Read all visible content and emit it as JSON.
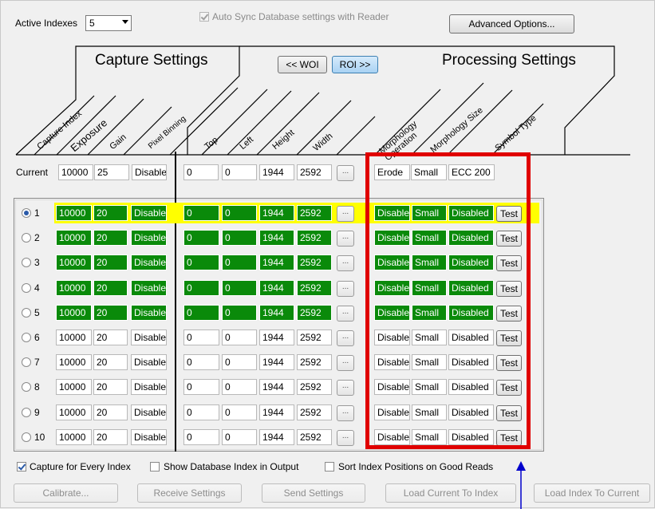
{
  "top": {
    "active_indexes_label": "Active Indexes",
    "active_indexes_value": "5",
    "auto_sync_label": "Auto Sync Database settings with Reader",
    "advanced_button": "Advanced Options..."
  },
  "tabs": {
    "capture_title": "Capture Settings",
    "processing_title": "Processing Settings",
    "woi_button": "<< WOI",
    "roi_button": "ROI >>"
  },
  "headers": [
    "Capture Index",
    "Exposure",
    "Gain",
    "Pixel Binning",
    "Top",
    "Left",
    "Height",
    "Width",
    "Morphology Operation",
    "Morphology Size",
    "Symbol Type"
  ],
  "current": {
    "label": "Current",
    "exposure": "10000",
    "gain": "25",
    "binning": "Disable",
    "top": "0",
    "left": "0",
    "height": "1944",
    "width": "2592",
    "morph_op": "Erode",
    "morph_size": "Small",
    "symbol_type": "ECC 200"
  },
  "ellipsis": "...",
  "test_label": "Test",
  "rows": [
    {
      "idx": "1",
      "exposure": "10000",
      "gain": "20",
      "binning": "Disable",
      "top": "0",
      "left": "0",
      "height": "1944",
      "width": "2592",
      "op": "Disable",
      "size": "Small",
      "symbol": "Disabled"
    },
    {
      "idx": "2",
      "exposure": "10000",
      "gain": "20",
      "binning": "Disable",
      "top": "0",
      "left": "0",
      "height": "1944",
      "width": "2592",
      "op": "Disable",
      "size": "Small",
      "symbol": "Disabled"
    },
    {
      "idx": "3",
      "exposure": "10000",
      "gain": "20",
      "binning": "Disable",
      "top": "0",
      "left": "0",
      "height": "1944",
      "width": "2592",
      "op": "Disable",
      "size": "Small",
      "symbol": "Disabled"
    },
    {
      "idx": "4",
      "exposure": "10000",
      "gain": "20",
      "binning": "Disable",
      "top": "0",
      "left": "0",
      "height": "1944",
      "width": "2592",
      "op": "Disable",
      "size": "Small",
      "symbol": "Disabled"
    },
    {
      "idx": "5",
      "exposure": "10000",
      "gain": "20",
      "binning": "Disable",
      "top": "0",
      "left": "0",
      "height": "1944",
      "width": "2592",
      "op": "Disable",
      "size": "Small",
      "symbol": "Disabled"
    },
    {
      "idx": "6",
      "exposure": "10000",
      "gain": "20",
      "binning": "Disable",
      "top": "0",
      "left": "0",
      "height": "1944",
      "width": "2592",
      "op": "Disable",
      "size": "Small",
      "symbol": "Disabled"
    },
    {
      "idx": "7",
      "exposure": "10000",
      "gain": "20",
      "binning": "Disable",
      "top": "0",
      "left": "0",
      "height": "1944",
      "width": "2592",
      "op": "Disable",
      "size": "Small",
      "symbol": "Disabled"
    },
    {
      "idx": "8",
      "exposure": "10000",
      "gain": "20",
      "binning": "Disable",
      "top": "0",
      "left": "0",
      "height": "1944",
      "width": "2592",
      "op": "Disable",
      "size": "Small",
      "symbol": "Disabled"
    },
    {
      "idx": "9",
      "exposure": "10000",
      "gain": "20",
      "binning": "Disable",
      "top": "0",
      "left": "0",
      "height": "1944",
      "width": "2592",
      "op": "Disable",
      "size": "Small",
      "symbol": "Disabled"
    },
    {
      "idx": "10",
      "exposure": "10000",
      "gain": "20",
      "binning": "Disable",
      "top": "0",
      "left": "0",
      "height": "1944",
      "width": "2592",
      "op": "Disable",
      "size": "Small",
      "symbol": "Disabled"
    }
  ],
  "row_state": {
    "selected_row": "1",
    "active_rows": "5"
  },
  "options": {
    "capture_every": "Capture for Every Index",
    "show_db_index": "Show Database Index in Output",
    "sort_index": "Sort Index Positions on Good Reads"
  },
  "buttons": {
    "calibrate": "Calibrate...",
    "receive": "Receive Settings",
    "send": "Send Settings",
    "load_current": "Load Current To Index",
    "load_index": "Load Index To Current"
  },
  "colors": {
    "active_cell": "#0a8a0a",
    "highlight_row": "#ffff00",
    "callout": "#e00000",
    "arrow": "#0000cc"
  }
}
